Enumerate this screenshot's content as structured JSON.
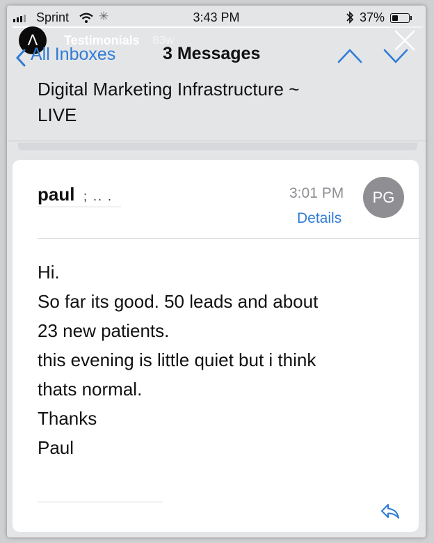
{
  "status_bar": {
    "carrier": "Sprint",
    "time": "3:43 PM",
    "battery_percent": "37%",
    "battery_level": 0.37,
    "icons": [
      "signal-icon",
      "wifi-icon",
      "loading-spinner-icon",
      "bluetooth-icon",
      "battery-icon"
    ]
  },
  "story": {
    "avatar_letter": "Λ",
    "name": "Testimonials",
    "age": "83w",
    "progress": 0.92,
    "icons": [
      "close-icon"
    ]
  },
  "nav": {
    "back_label": "All Inboxes",
    "message_count": "3 Messages",
    "icons": [
      "chevron-left-icon",
      "chevron-up-icon",
      "chevron-down-icon"
    ]
  },
  "subject": {
    "line1": "Digital Marketing Infrastructure ~",
    "line2": "LIVE"
  },
  "message": {
    "sender": "paul",
    "sender_obscured": "; .. .",
    "time": "3:01 PM",
    "details_label": "Details",
    "avatar_initials": "PG",
    "body": [
      "Hi.",
      "So far its good. 50 leads and about",
      "23 new patients.",
      "this evening is little quiet but i think",
      "thats normal.",
      "Thanks",
      "Paul"
    ],
    "icons": [
      "reply-icon"
    ]
  },
  "colors": {
    "accent": "#2f7bd6",
    "header_bg": "#e4e5e7",
    "avatar_bg": "#8e8e93",
    "card_bg": "#ffffff"
  }
}
